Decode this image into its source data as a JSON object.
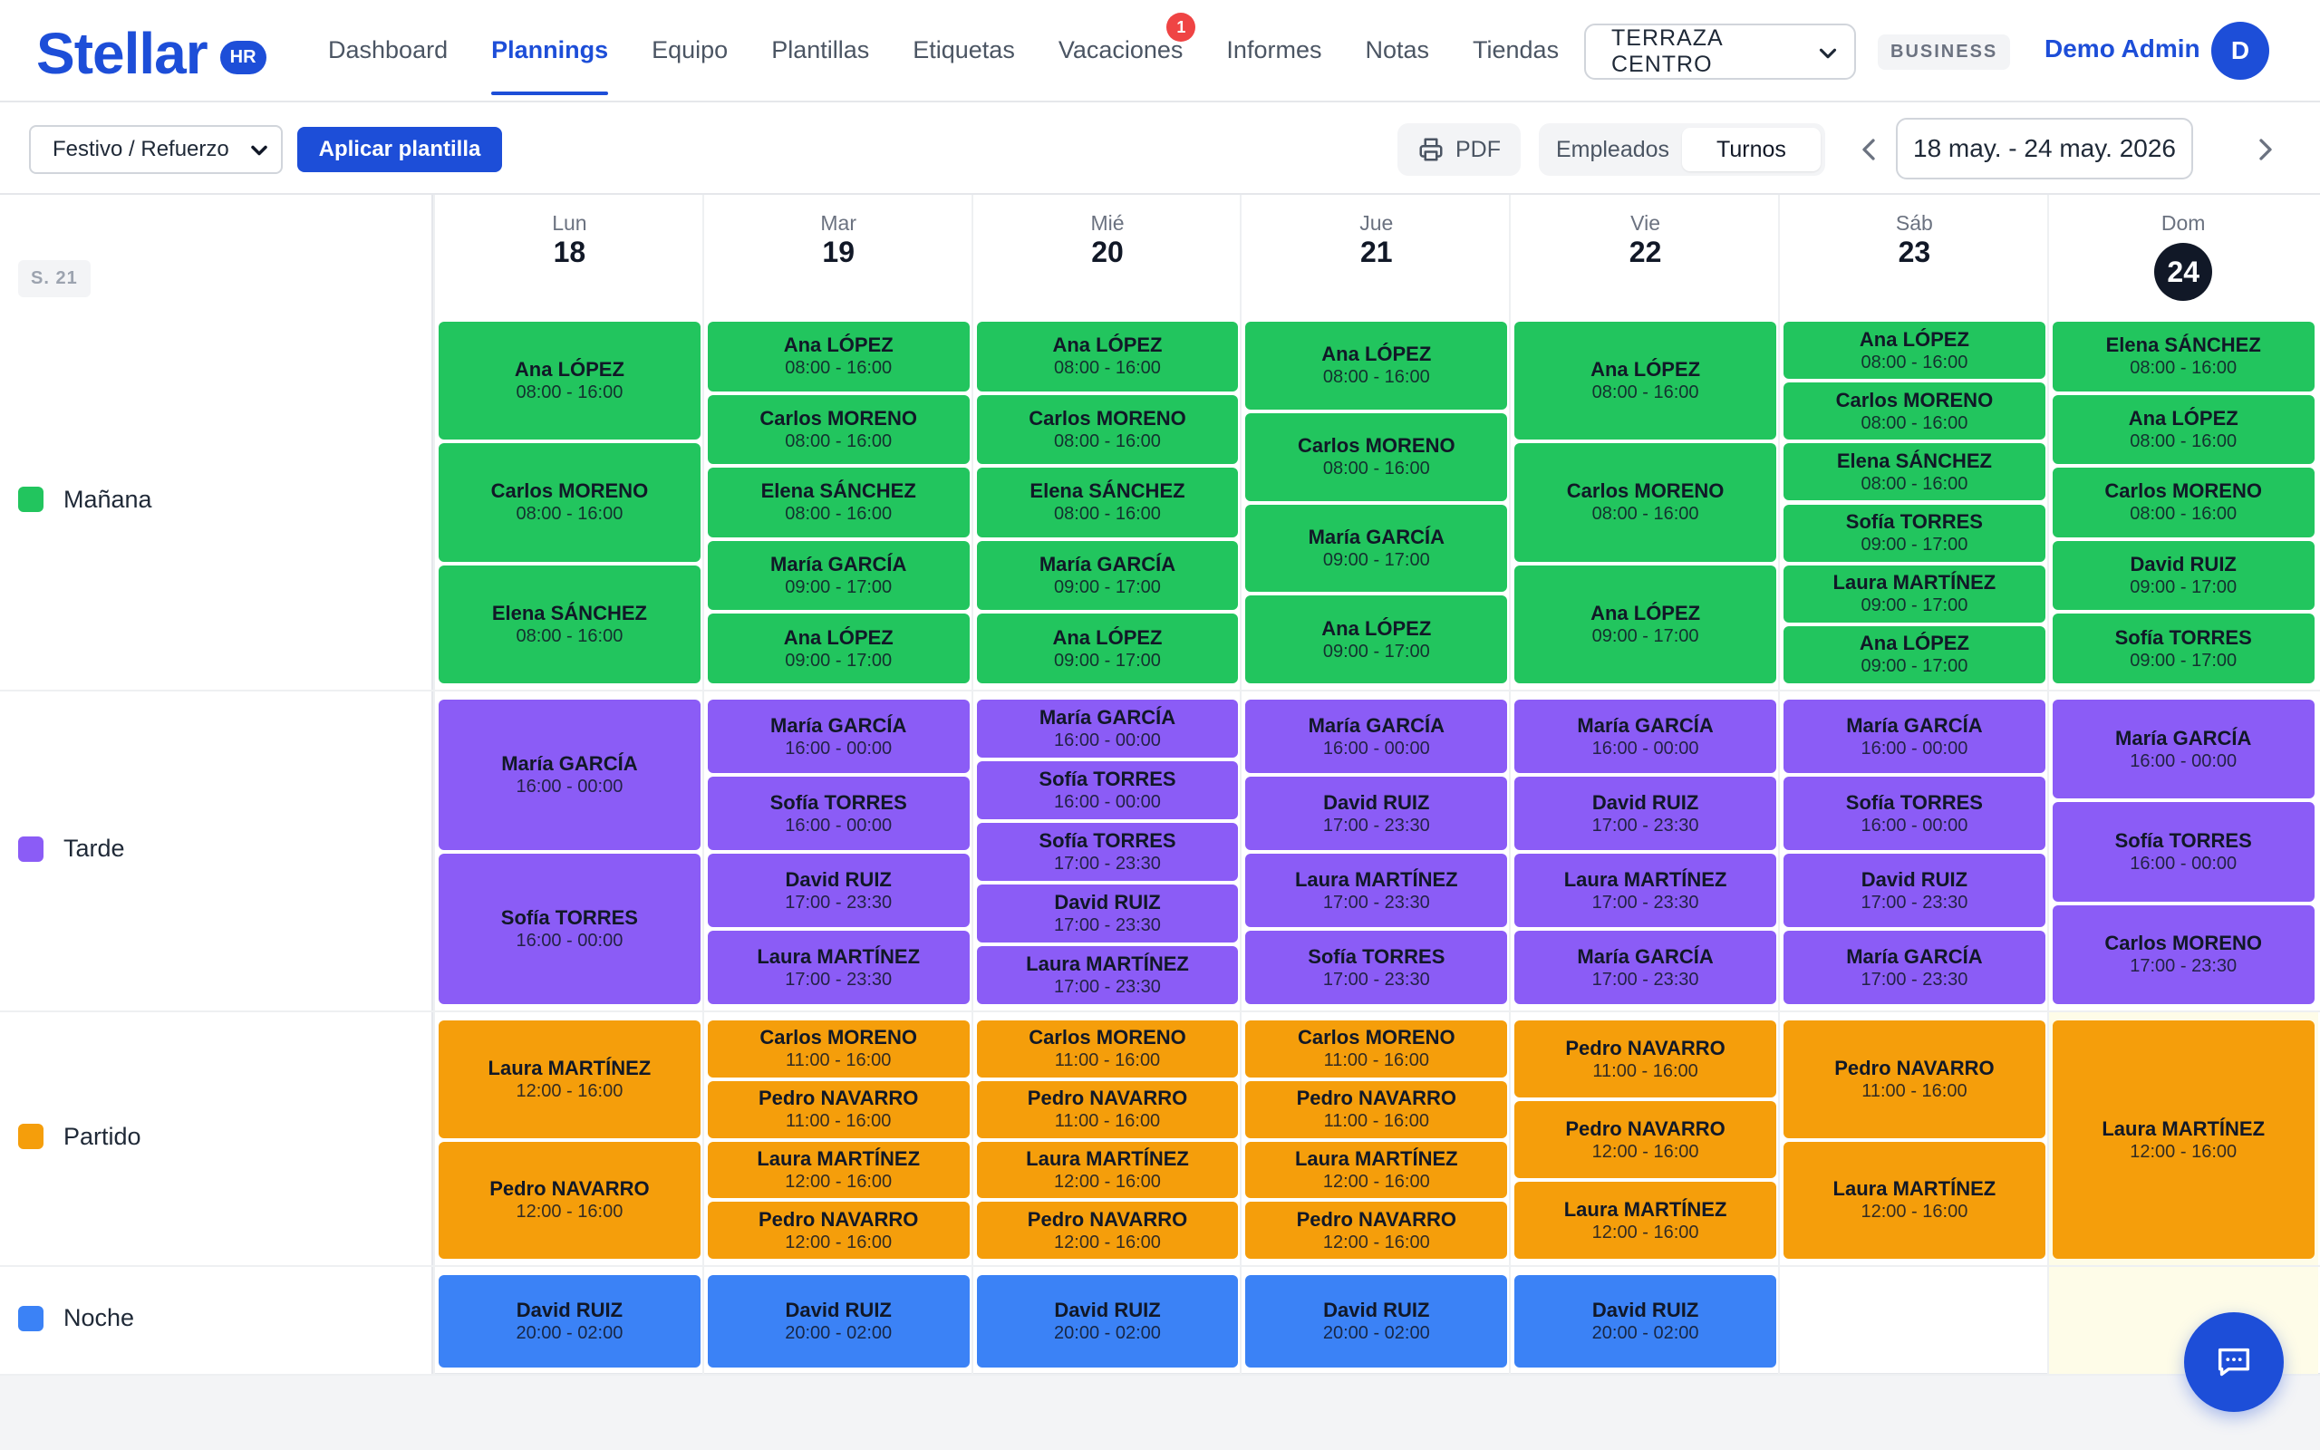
{
  "brand": {
    "name": "Stellar",
    "badge": "HR"
  },
  "nav": [
    {
      "label": "Dashboard",
      "active": false,
      "badge": null
    },
    {
      "label": "Plannings",
      "active": true,
      "badge": null
    },
    {
      "label": "Equipo",
      "active": false,
      "badge": null
    },
    {
      "label": "Plantillas",
      "active": false,
      "badge": null
    },
    {
      "label": "Etiquetas",
      "active": false,
      "badge": null
    },
    {
      "label": "Vacaciones",
      "active": false,
      "badge": "1"
    },
    {
      "label": "Informes",
      "active": false,
      "badge": null
    },
    {
      "label": "Notas",
      "active": false,
      "badge": null
    },
    {
      "label": "Tiendas",
      "active": false,
      "badge": null
    }
  ],
  "store_select": {
    "value": "TERRAZA CENTRO"
  },
  "plan_badge": "BUSINESS",
  "user": {
    "name": "Demo Admin",
    "initial": "D"
  },
  "toolbar": {
    "template_value": "Festivo / Refuerzo",
    "apply_label": "Aplicar plantilla",
    "pdf_label": "PDF",
    "view_toggle": {
      "employees": "Empleados",
      "shifts": "Turnos",
      "selected": "shifts"
    },
    "date_range": "18 may. - 24 may. 2026"
  },
  "week_label": "S. 21",
  "colors": {
    "manana": "#22c55e",
    "tarde": "#8b5cf6",
    "partido": "#f59e0b",
    "noche": "#3b82f6",
    "brand": "#1d4ed8"
  },
  "rows": [
    {
      "key": "manana",
      "label": "Mañana"
    },
    {
      "key": "tarde",
      "label": "Tarde"
    },
    {
      "key": "partido",
      "label": "Partido"
    },
    {
      "key": "noche",
      "label": "Noche"
    }
  ],
  "days": [
    {
      "name": "Lun",
      "num": "18",
      "today": false
    },
    {
      "name": "Mar",
      "num": "19",
      "today": false
    },
    {
      "name": "Mié",
      "num": "20",
      "today": false
    },
    {
      "name": "Jue",
      "num": "21",
      "today": false
    },
    {
      "name": "Vie",
      "num": "22",
      "today": false
    },
    {
      "name": "Sáb",
      "num": "23",
      "today": false
    },
    {
      "name": "Dom",
      "num": "24",
      "today": true
    }
  ],
  "shifts": {
    "manana": [
      [
        [
          "Ana LÓPEZ",
          "08:00 - 16:00"
        ],
        [
          "Carlos MORENO",
          "08:00 - 16:00"
        ],
        [
          "Elena SÁNCHEZ",
          "08:00 - 16:00"
        ]
      ],
      [
        [
          "Ana LÓPEZ",
          "08:00 - 16:00"
        ],
        [
          "Carlos MORENO",
          "08:00 - 16:00"
        ],
        [
          "Elena SÁNCHEZ",
          "08:00 - 16:00"
        ],
        [
          "María GARCÍA",
          "09:00 - 17:00"
        ],
        [
          "Ana LÓPEZ",
          "09:00 - 17:00"
        ]
      ],
      [
        [
          "Ana LÓPEZ",
          "08:00 - 16:00"
        ],
        [
          "Carlos MORENO",
          "08:00 - 16:00"
        ],
        [
          "Elena SÁNCHEZ",
          "08:00 - 16:00"
        ],
        [
          "María GARCÍA",
          "09:00 - 17:00"
        ],
        [
          "Ana LÓPEZ",
          "09:00 - 17:00"
        ]
      ],
      [
        [
          "Ana LÓPEZ",
          "08:00 - 16:00"
        ],
        [
          "Carlos MORENO",
          "08:00 - 16:00"
        ],
        [
          "María GARCÍA",
          "09:00 - 17:00"
        ],
        [
          "Ana LÓPEZ",
          "09:00 - 17:00"
        ]
      ],
      [
        [
          "Ana LÓPEZ",
          "08:00 - 16:00"
        ],
        [
          "Carlos MORENO",
          "08:00 - 16:00"
        ],
        [
          "Ana LÓPEZ",
          "09:00 - 17:00"
        ]
      ],
      [
        [
          "Ana LÓPEZ",
          "08:00 - 16:00"
        ],
        [
          "Carlos MORENO",
          "08:00 - 16:00"
        ],
        [
          "Elena SÁNCHEZ",
          "08:00 - 16:00"
        ],
        [
          "Sofía TORRES",
          "09:00 - 17:00"
        ],
        [
          "Laura MARTÍNEZ",
          "09:00 - 17:00"
        ],
        [
          "Ana LÓPEZ",
          "09:00 - 17:00"
        ]
      ],
      [
        [
          "Elena SÁNCHEZ",
          "08:00 - 16:00"
        ],
        [
          "Ana LÓPEZ",
          "08:00 - 16:00"
        ],
        [
          "Carlos MORENO",
          "08:00 - 16:00"
        ],
        [
          "David RUIZ",
          "09:00 - 17:00"
        ],
        [
          "Sofía TORRES",
          "09:00 - 17:00"
        ]
      ]
    ],
    "tarde": [
      [
        [
          "María GARCÍA",
          "16:00 - 00:00"
        ],
        [
          "Sofía TORRES",
          "16:00 - 00:00"
        ]
      ],
      [
        [
          "María GARCÍA",
          "16:00 - 00:00"
        ],
        [
          "Sofía TORRES",
          "16:00 - 00:00"
        ],
        [
          "David RUIZ",
          "17:00 - 23:30"
        ],
        [
          "Laura MARTÍNEZ",
          "17:00 - 23:30"
        ]
      ],
      [
        [
          "María GARCÍA",
          "16:00 - 00:00"
        ],
        [
          "Sofía TORRES",
          "16:00 - 00:00"
        ],
        [
          "Sofía TORRES",
          "17:00 - 23:30"
        ],
        [
          "David RUIZ",
          "17:00 - 23:30"
        ],
        [
          "Laura MARTÍNEZ",
          "17:00 - 23:30"
        ]
      ],
      [
        [
          "María GARCÍA",
          "16:00 - 00:00"
        ],
        [
          "David RUIZ",
          "17:00 - 23:30"
        ],
        [
          "Laura MARTÍNEZ",
          "17:00 - 23:30"
        ],
        [
          "Sofía TORRES",
          "17:00 - 23:30"
        ]
      ],
      [
        [
          "María GARCÍA",
          "16:00 - 00:00"
        ],
        [
          "David RUIZ",
          "17:00 - 23:30"
        ],
        [
          "Laura MARTÍNEZ",
          "17:00 - 23:30"
        ],
        [
          "María GARCÍA",
          "17:00 - 23:30"
        ]
      ],
      [
        [
          "María GARCÍA",
          "16:00 - 00:00"
        ],
        [
          "Sofía TORRES",
          "16:00 - 00:00"
        ],
        [
          "David RUIZ",
          "17:00 - 23:30"
        ],
        [
          "María GARCÍA",
          "17:00 - 23:30"
        ]
      ],
      [
        [
          "María GARCÍA",
          "16:00 - 00:00"
        ],
        [
          "Sofía TORRES",
          "16:00 - 00:00"
        ],
        [
          "Carlos MORENO",
          "17:00 - 23:30"
        ]
      ]
    ],
    "partido": [
      [
        [
          "Laura MARTÍNEZ",
          "12:00 - 16:00"
        ],
        [
          "Pedro NAVARRO",
          "12:00 - 16:00"
        ]
      ],
      [
        [
          "Carlos MORENO",
          "11:00 - 16:00"
        ],
        [
          "Pedro NAVARRO",
          "11:00 - 16:00"
        ],
        [
          "Laura MARTÍNEZ",
          "12:00 - 16:00"
        ],
        [
          "Pedro NAVARRO",
          "12:00 - 16:00"
        ]
      ],
      [
        [
          "Carlos MORENO",
          "11:00 - 16:00"
        ],
        [
          "Pedro NAVARRO",
          "11:00 - 16:00"
        ],
        [
          "Laura MARTÍNEZ",
          "12:00 - 16:00"
        ],
        [
          "Pedro NAVARRO",
          "12:00 - 16:00"
        ]
      ],
      [
        [
          "Carlos MORENO",
          "11:00 - 16:00"
        ],
        [
          "Pedro NAVARRO",
          "11:00 - 16:00"
        ],
        [
          "Laura MARTÍNEZ",
          "12:00 - 16:00"
        ],
        [
          "Pedro NAVARRO",
          "12:00 - 16:00"
        ]
      ],
      [
        [
          "Pedro NAVARRO",
          "11:00 - 16:00"
        ],
        [
          "Pedro NAVARRO",
          "12:00 - 16:00"
        ],
        [
          "Laura MARTÍNEZ",
          "12:00 - 16:00"
        ]
      ],
      [
        [
          "Pedro NAVARRO",
          "11:00 - 16:00"
        ],
        [
          "Laura MARTÍNEZ",
          "12:00 - 16:00"
        ]
      ],
      [
        [
          "Laura MARTÍNEZ",
          "12:00 - 16:00"
        ]
      ]
    ],
    "noche": [
      [
        [
          "David RUIZ",
          "20:00 - 02:00"
        ]
      ],
      [
        [
          "David RUIZ",
          "20:00 - 02:00"
        ]
      ],
      [
        [
          "David RUIZ",
          "20:00 - 02:00"
        ]
      ],
      [
        [
          "David RUIZ",
          "20:00 - 02:00"
        ]
      ],
      [
        [
          "David RUIZ",
          "20:00 - 02:00"
        ]
      ],
      [],
      []
    ]
  }
}
